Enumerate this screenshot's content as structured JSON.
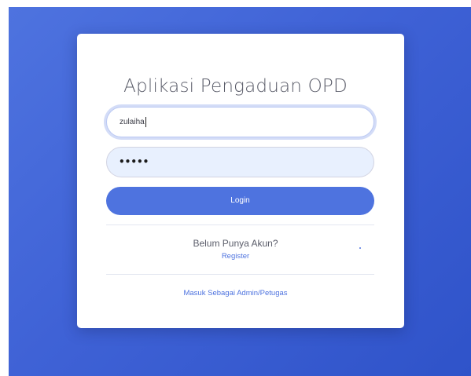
{
  "app": {
    "title": "Aplikasi Pengaduan OPD"
  },
  "form": {
    "username_value": "zulaiha",
    "password_masked": "•••••",
    "login_label": "Login"
  },
  "register": {
    "question": "Belum Punya Akun?",
    "link_label": "Register"
  },
  "admin": {
    "link_label": "Masuk Sebagai Admin/Petugas"
  },
  "colors": {
    "primary": "#4e73df",
    "background_gradient_start": "#4e73df",
    "background_gradient_end": "#2f53c9",
    "password_fill": "#e8f0fe"
  }
}
